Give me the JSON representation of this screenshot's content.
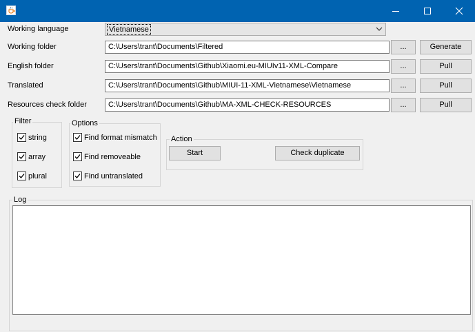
{
  "window": {
    "icon": "java-cup-icon",
    "controls": [
      "minimize-icon",
      "maximize-icon",
      "close-icon"
    ]
  },
  "rows": {
    "working_language": {
      "label": "Working language",
      "value": "Vietnamese"
    },
    "working_folder": {
      "label": "Working folder",
      "value": "C:\\Users\\trant\\Documents\\Filtered",
      "browse": "...",
      "action": "Generate"
    },
    "english_folder": {
      "label": "English folder",
      "value": "C:\\Users\\trant\\Documents\\Github\\Xiaomi.eu-MIUIv11-XML-Compare",
      "browse": "...",
      "action": "Pull"
    },
    "translated": {
      "label": "Translated",
      "value": "C:\\Users\\trant\\Documents\\Github\\MIUI-11-XML-Vietnamese\\Vietnamese",
      "browse": "...",
      "action": "Pull"
    },
    "resources_check": {
      "label": "Resources check folder",
      "value": "C:\\Users\\trant\\Documents\\Github\\MA-XML-CHECK-RESOURCES",
      "browse": "...",
      "action": "Pull"
    }
  },
  "filter": {
    "title": "Filter",
    "items": [
      {
        "label": "string",
        "checked": true
      },
      {
        "label": "array",
        "checked": true
      },
      {
        "label": "plural",
        "checked": true
      }
    ]
  },
  "options": {
    "title": "Options",
    "items": [
      {
        "label": "Find format mismatch",
        "checked": true
      },
      {
        "label": "Find removeable",
        "checked": true
      },
      {
        "label": "Find untranslated",
        "checked": true
      }
    ]
  },
  "action": {
    "title": "Action",
    "start": "Start",
    "check_duplicate": "Check duplicate"
  },
  "log": {
    "title": "Log",
    "content": ""
  }
}
